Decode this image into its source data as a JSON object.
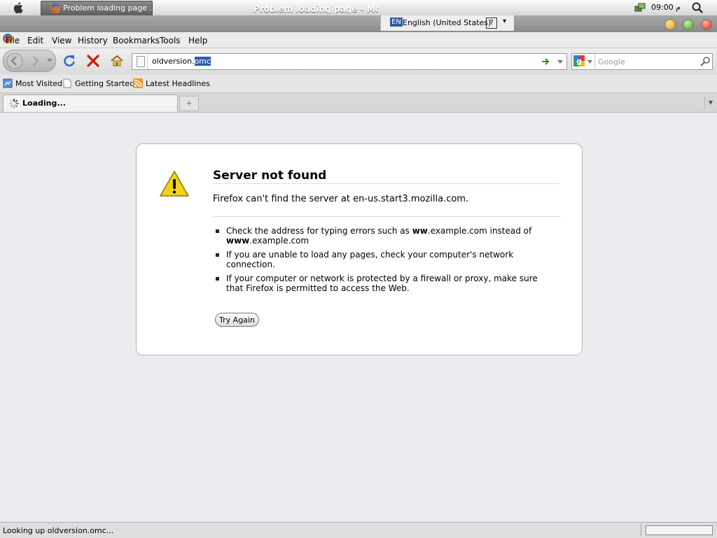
{
  "os_bar": {
    "task_label": "Problem loading page ...",
    "clock": "م 09:00"
  },
  "window": {
    "title": "Problem loading page - Mozilla Firefox"
  },
  "language_bar": {
    "code": "EN",
    "language": "English (United States)",
    "help": "?",
    "menu_arrow": "▾"
  },
  "menu": {
    "file": "File",
    "edit": "Edit",
    "view": "View",
    "history": "History",
    "bookmarks": "Bookmarks",
    "tools": "Tools",
    "help": "Help"
  },
  "navbar": {
    "url_prefix": "oldversion.",
    "url_selected": "omc",
    "search_placeholder": "Google"
  },
  "bookmarks": [
    {
      "label": "Most Visited"
    },
    {
      "label": "Getting Started"
    },
    {
      "label": "Latest Headlines"
    }
  ],
  "tabs": {
    "active_label": "Loading...",
    "new_tab": "+",
    "list_arrow": "▼"
  },
  "error": {
    "title": "Server not found",
    "short_desc": "Firefox can't find the server at en-us.start3.mozilla.com.",
    "bullet1_a": "Check the address for typing errors such as ",
    "bullet1_b": "ww",
    "bullet1_c": ".example.com instead of ",
    "bullet1_d": "www",
    "bullet1_e": ".example.com",
    "bullet2": "If you are unable to load any pages, check your computer's network connection.",
    "bullet3": "If your computer or network is protected by a firewall or proxy, make sure that Firefox is permitted to access the Web.",
    "button": "Try Again"
  },
  "status": {
    "text": "Looking up oldversion.omc...",
    "progress": 0
  },
  "colors": {
    "selection": "#2e5fa8",
    "stop_red": "#cc1a12",
    "reload_blue": "#2a6cc8"
  }
}
